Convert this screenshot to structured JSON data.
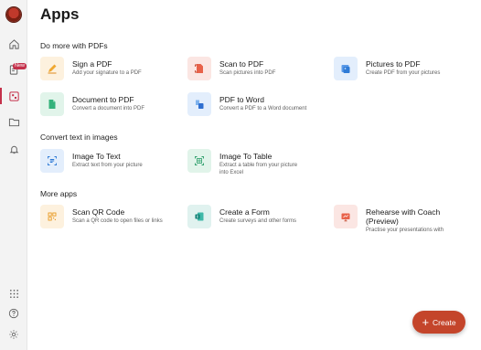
{
  "header": {
    "title": "Apps"
  },
  "sidebar": {
    "new_badge": "New"
  },
  "sections": [
    {
      "title": "Do more with PDFs"
    },
    {
      "title": "Convert text in images"
    },
    {
      "title": "More apps"
    }
  ],
  "apps": {
    "sign_pdf": {
      "name": "Sign a PDF",
      "desc": "Add your signature to a PDF"
    },
    "scan_pdf": {
      "name": "Scan to PDF",
      "desc": "Scan pictures into PDF"
    },
    "pictures_pdf": {
      "name": "Pictures to PDF",
      "desc": "Create PDF from your pictures"
    },
    "doc_pdf": {
      "name": "Document to PDF",
      "desc": "Convert a document into PDF"
    },
    "pdf_word": {
      "name": "PDF to Word",
      "desc": "Convert a PDF to a Word document"
    },
    "image_text": {
      "name": "Image To Text",
      "desc": "Extract text from your picture"
    },
    "image_table": {
      "name": "Image To Table",
      "desc_1": "Extract a table from your picture",
      "desc_2": "into Excel"
    },
    "scan_qr": {
      "name": "Scan QR Code",
      "desc": "Scan a QR code to open files or links"
    },
    "create_form": {
      "name": "Create a Form",
      "desc": "Create surveys and other forms"
    },
    "rehearse": {
      "name_1": "Rehearse with Coach",
      "name_2": "(Preview)",
      "desc": "Practise your presentations with"
    }
  },
  "create_button": {
    "label": "Create"
  },
  "colors": {
    "accent": "#c4452b",
    "badge": "#c4314b",
    "sidebar_bg": "#f3f3f3"
  }
}
